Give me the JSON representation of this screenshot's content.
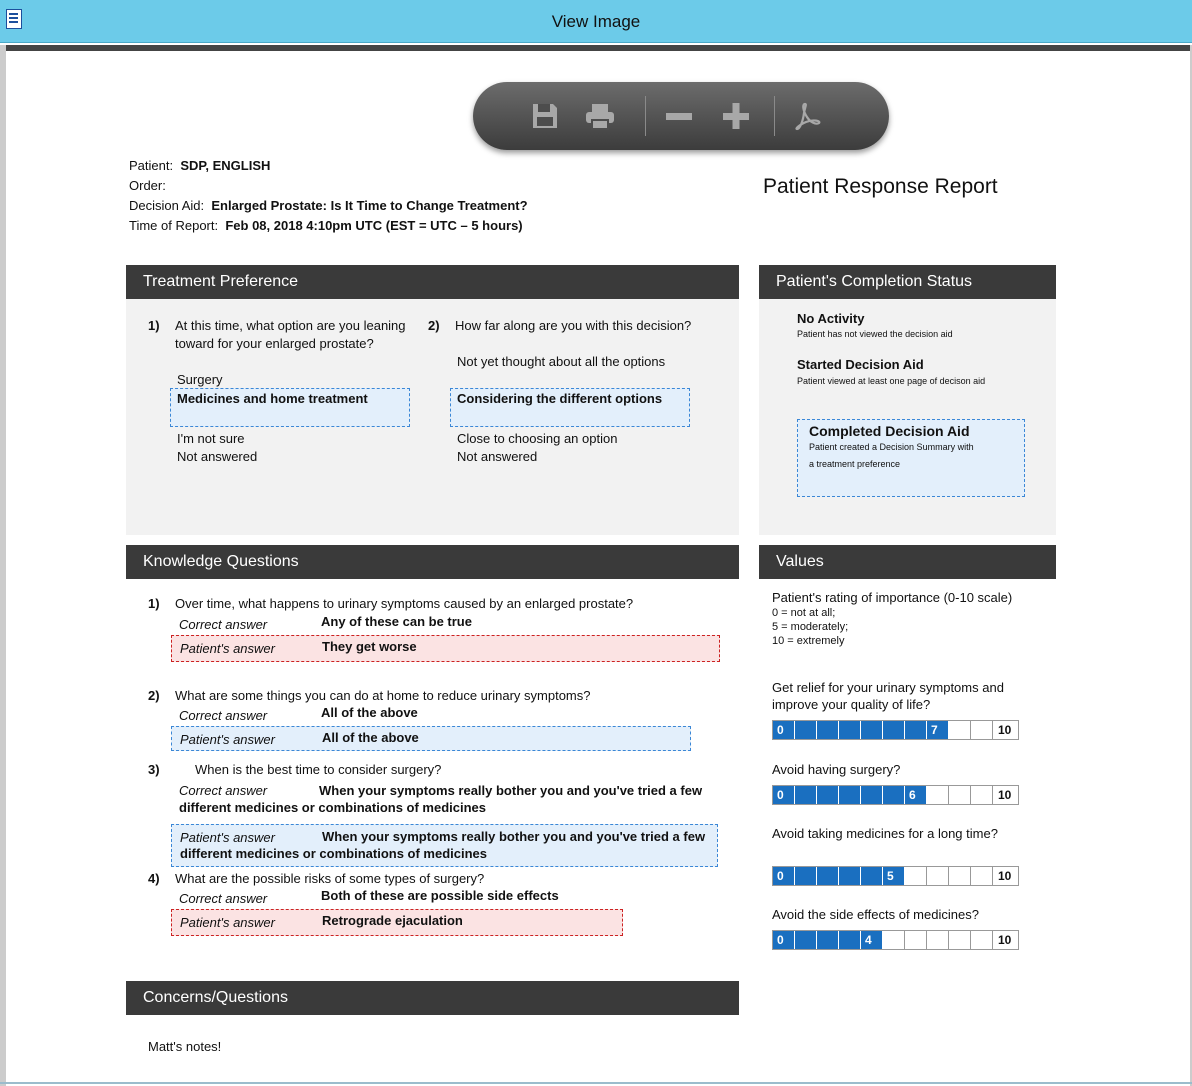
{
  "window": {
    "title": "View Image"
  },
  "toolbar": {
    "save_icon": "save-icon",
    "print_icon": "print-icon",
    "zoom_out_icon": "minus-icon",
    "zoom_in_icon": "plus-icon",
    "pdf_icon": "pdf-icon"
  },
  "header": {
    "patient_label": "Patient:",
    "patient_value": "SDP, ENGLISH",
    "order_label": "Order:",
    "decision_aid_label": "Decision Aid:",
    "decision_aid_value": "Enlarged Prostate: Is It Time to Change Treatment?",
    "time_label": "Time of Report:",
    "time_value": "Feb 08, 2018 4:10pm UTC (EST = UTC – 5 hours)",
    "report_title": "Patient Response Report"
  },
  "treatment_preference": {
    "title": "Treatment Preference",
    "q1": {
      "num": "1)",
      "text": "At this time, what option are you leaning toward for your enlarged prostate?",
      "options": [
        "Surgery",
        "Medicines and home treatment",
        "I'm not sure",
        "Not answered"
      ]
    },
    "q2": {
      "num": "2)",
      "text": "How far along are you with this decision?",
      "options": [
        "Not yet thought about all the options",
        "Considering the different options",
        "Close to choosing an option",
        "Not answered"
      ]
    }
  },
  "completion_status": {
    "title": "Patient's Completion Status",
    "items": [
      {
        "title": "No Activity",
        "desc": "Patient has not viewed the decision aid"
      },
      {
        "title": "Started Decision Aid",
        "desc": "Patient viewed at least one page of decison aid"
      },
      {
        "title": "Completed Decision Aid",
        "desc": "Patient created a Decision Summary with a treatment preference"
      }
    ]
  },
  "knowledge": {
    "title": "Knowledge Questions",
    "correct_label": "Correct answer",
    "patient_label": "Patient's answer",
    "questions": [
      {
        "num": "1)",
        "text": "Over time, what happens to urinary symptoms caused by an enlarged prostate?",
        "correct": "Any of these can be true",
        "patient": "They get worse"
      },
      {
        "num": "2)",
        "text": "What are some things you can do at home to reduce urinary symptoms?",
        "correct": "All of the above",
        "patient": "All of the above"
      },
      {
        "num": "3)",
        "text": "When is the best time to consider surgery?",
        "correct": "When your symptoms really bother you and you've tried a few different medicines or combinations of medicines",
        "patient": "When your symptoms really bother you and you've tried a few different medicines or combinations of medicines"
      },
      {
        "num": "4)",
        "text": "What are the possible risks of some types of surgery?",
        "correct": "Both of these are possible side effects",
        "patient": "Retrograde ejaculation"
      }
    ]
  },
  "values": {
    "title": "Values",
    "intro": "Patient's rating of importance (0-10 scale)",
    "legend": [
      "0 = not at all;",
      "5 = moderately;",
      "10 = extremely"
    ],
    "scale_min": "0",
    "scale_max": "10",
    "items": [
      {
        "question": "Get relief for your urinary symptoms and improve your quality of life?",
        "rating": 7
      },
      {
        "question": "Avoid having surgery?",
        "rating": 6
      },
      {
        "question": "Avoid taking medicines for a long time?",
        "rating": 5
      },
      {
        "question": "Avoid the side effects of medicines?",
        "rating": 4
      }
    ]
  },
  "concerns": {
    "title": "Concerns/Questions",
    "text": "Matt's notes!"
  }
}
